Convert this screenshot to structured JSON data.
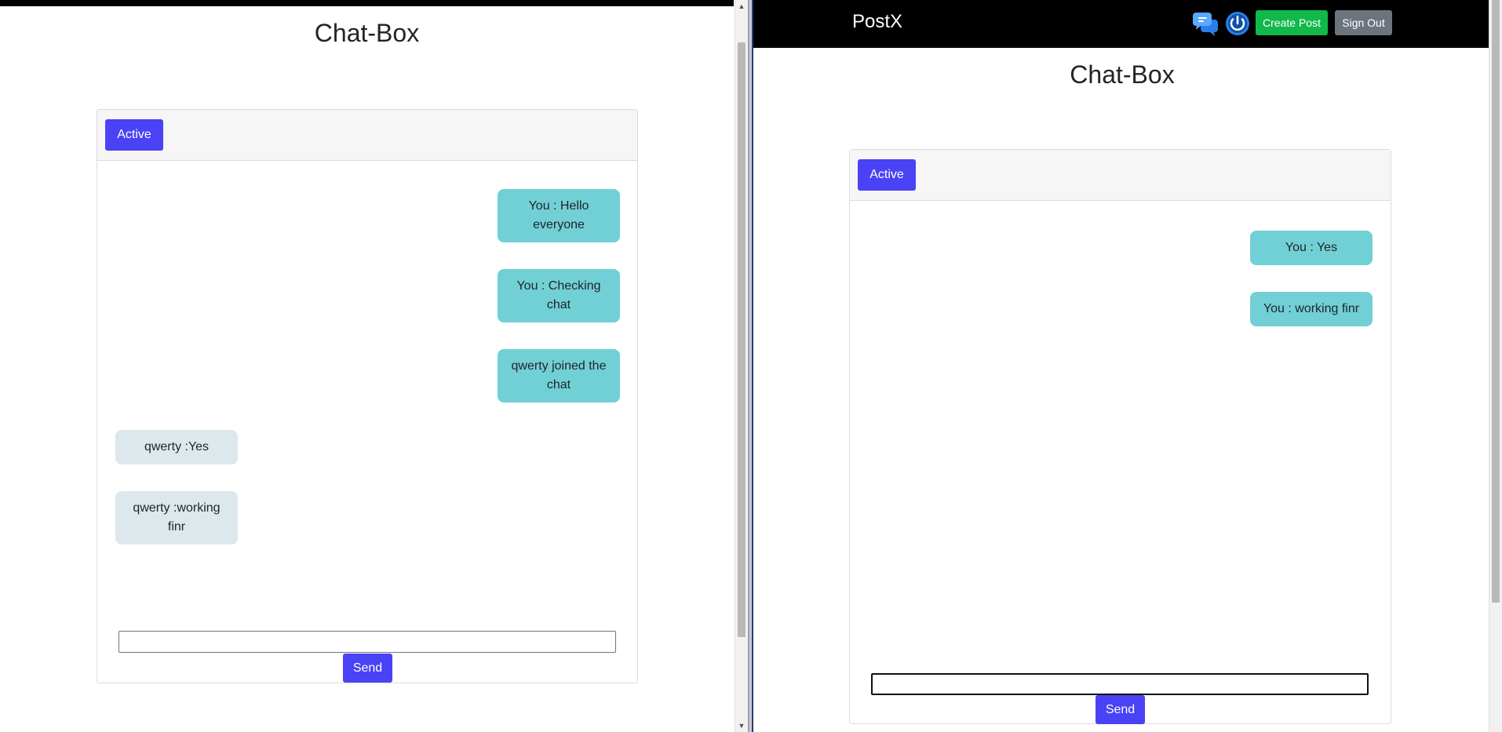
{
  "left_window": {
    "title": "Chat-Box",
    "active_label": "Active",
    "messages": [
      {
        "text": "You : Hello everyone",
        "own": true
      },
      {
        "text": "You : Checking chat",
        "own": true
      },
      {
        "text": "qwerty joined the chat",
        "own": true
      },
      {
        "text": "qwerty :Yes",
        "own": false
      },
      {
        "text": "qwerty :working finr",
        "own": false
      }
    ],
    "input_value": "",
    "send_label": "Send"
  },
  "right_window": {
    "brand": "PostX",
    "icons": [
      "chat-bubbles-icon",
      "power-icon"
    ],
    "create_post_label": "Create Post",
    "sign_out_label": "Sign Out",
    "title": "Chat-Box",
    "active_label": "Active",
    "messages": [
      {
        "text": "You : Yes",
        "own": true
      },
      {
        "text": "You : working finr",
        "own": true
      }
    ],
    "input_value": "",
    "send_label": "Send"
  },
  "colors": {
    "accent": "#4a42f5",
    "own_bubble": "#71d0d6",
    "other_bubble": "#dde8ec",
    "create_post": "#11b84a",
    "sign_out": "#6c757d",
    "navbar": "#000000"
  }
}
